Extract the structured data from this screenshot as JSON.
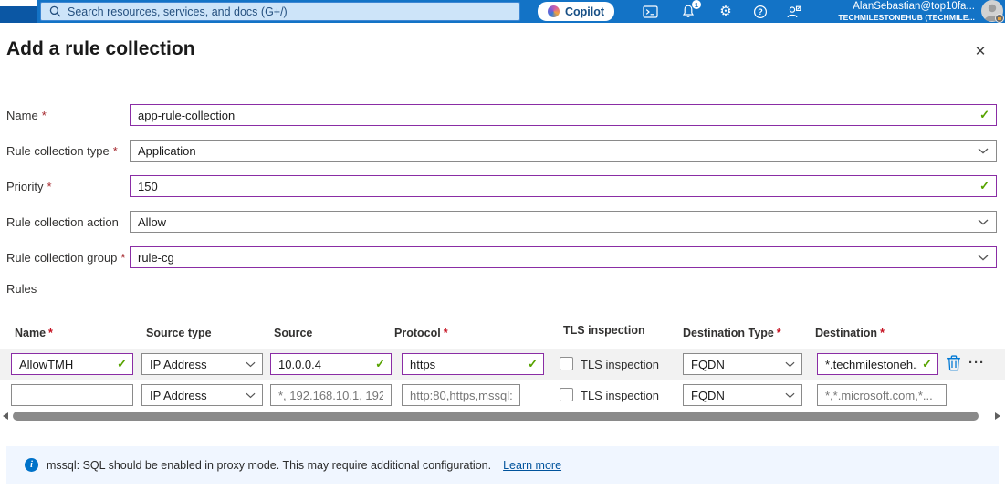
{
  "topbar": {
    "search": {
      "placeholder": "Search resources, services, and docs (G+/)"
    },
    "copilot": {
      "label": "Copilot"
    },
    "notifications": {
      "count": "1"
    },
    "account": {
      "email": "AlanSebastian@top10fa...",
      "tenant": "TECHMILESTONEHUB (TECHMILE..."
    }
  },
  "panel": {
    "title": "Add a rule collection"
  },
  "form": {
    "fields": [
      {
        "label": "Name",
        "required": true,
        "value": "app-rule-collection"
      },
      {
        "label": "Rule collection type",
        "required": true,
        "value": "Application"
      },
      {
        "label": "Priority",
        "required": true,
        "value": "150"
      },
      {
        "label": "Rule collection action",
        "required": false,
        "value": "Allow"
      },
      {
        "label": "Rule collection group",
        "required": true,
        "value": "rule-cg"
      }
    ]
  },
  "rules": {
    "section_label": "Rules",
    "headers": {
      "name": "Name",
      "source_type": "Source type",
      "source": "Source",
      "protocol": "Protocol",
      "tls": "TLS inspection",
      "destination_type": "Destination Type",
      "destination": "Destination"
    },
    "rows": [
      {
        "name": "AllowTMH",
        "source_type": "IP Address",
        "source": "10.0.0.4",
        "protocol": "https",
        "tls_label": "TLS inspection",
        "tls_checked": false,
        "destination_type": "FQDN",
        "destination": "*.techmilestoneh..."
      },
      {
        "name": "",
        "source_type": "IP Address",
        "source_placeholder": "*, 192.168.10.1, 192...",
        "protocol_placeholder": "http:80,https,mssql:...",
        "tls_label": "TLS inspection",
        "tls_checked": false,
        "destination_type": "FQDN",
        "destination_placeholder": "*,*.microsoft.com,*..."
      }
    ]
  },
  "banner": {
    "message": "mssql: SQL should be enabled in proxy mode. This may require additional configuration.",
    "link_label": "Learn more"
  },
  "icons": {
    "required": "*",
    "check": "✓",
    "close": "✕",
    "more": "···",
    "info": "i",
    "help": "?",
    "gear": "⚙"
  },
  "colors": {
    "topbar_blue": "#1373C6",
    "modified_purple": "#8A2DA5",
    "valid_green": "#57A300",
    "link_blue": "#00539C",
    "trash_blue": "#0078D4",
    "banner_bg": "#F0F6FF"
  }
}
